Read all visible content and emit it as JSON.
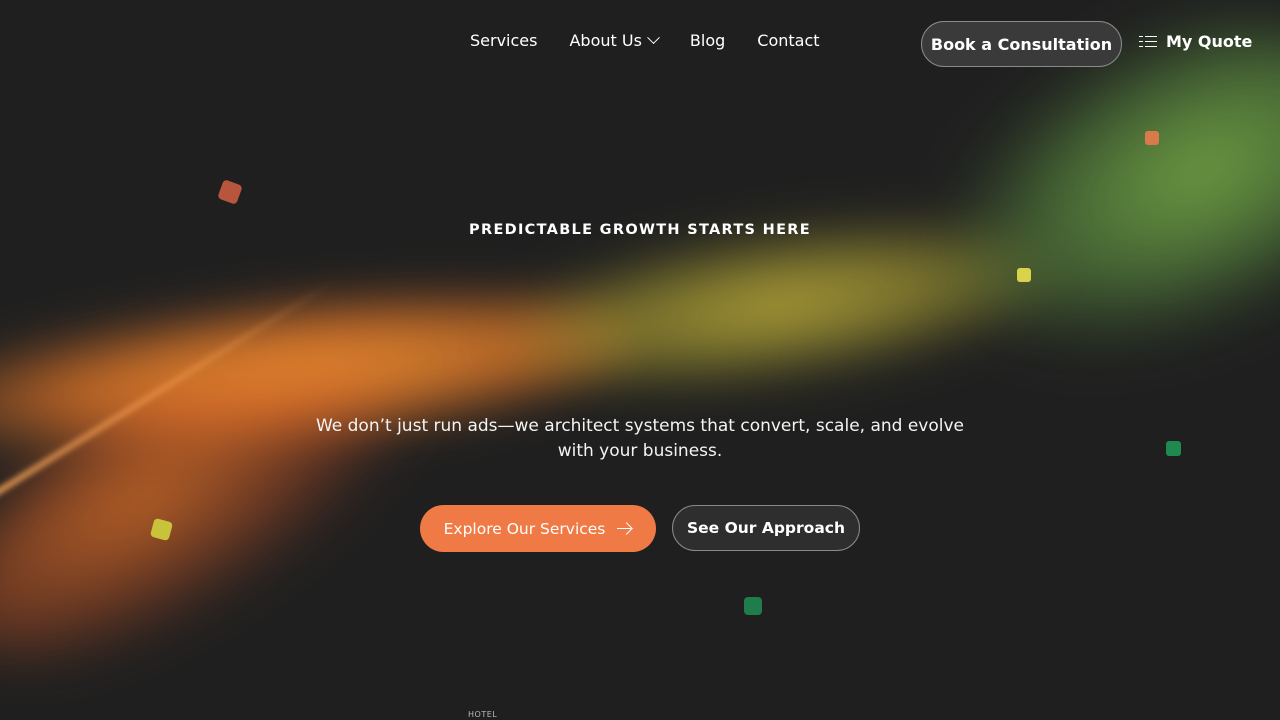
{
  "nav": {
    "links": [
      {
        "label": "Services"
      },
      {
        "label": "About Us"
      },
      {
        "label": "Blog"
      },
      {
        "label": "Contact"
      }
    ],
    "cta_label": "Book a Consultation",
    "quote_label": "My Quote"
  },
  "hero": {
    "eyebrow": "PREDICTABLE GROWTH STARTS HERE",
    "subtitle": "We don’t just run ads—we architect systems that convert, scale, and evolve with your business.",
    "primary_label": "Explore Our Services",
    "secondary_label": "See Our Approach"
  },
  "colors": {
    "accent": "#f07a45",
    "background": "#1f1f1f",
    "wave_orange": "#f0a032",
    "wave_yellow": "#c8b43c",
    "wave_green": "#78aa46"
  },
  "icons": {
    "about_dropdown": "chevron-down-icon",
    "quote": "list-icon",
    "primary_button": "arrow-right-icon"
  },
  "logos": {
    "partial_logo_text": "HOTEL"
  }
}
